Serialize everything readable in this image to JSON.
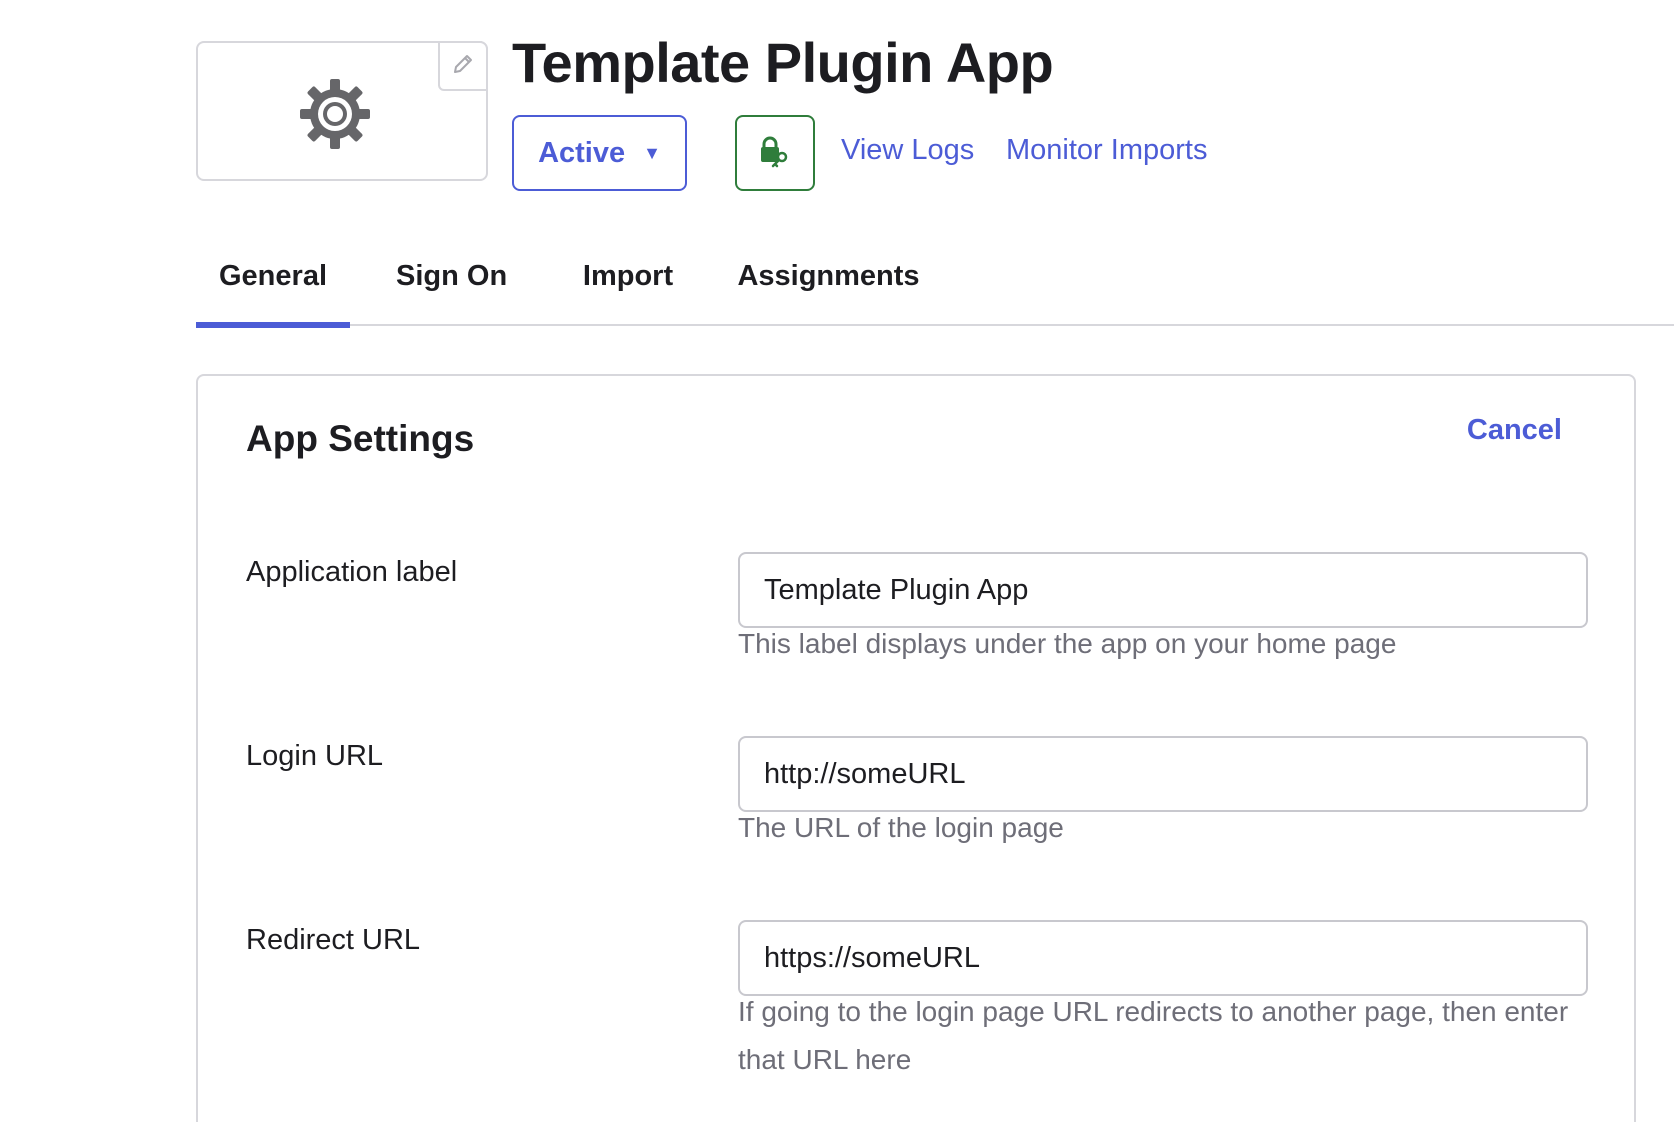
{
  "header": {
    "title": "Template Plugin App",
    "status_label": "Active",
    "links": {
      "view_logs": "View Logs",
      "monitor_imports": "Monitor Imports"
    },
    "icons": {
      "logo": "gear-icon",
      "edit": "pencil-icon",
      "provisioning": "lock-key-icon",
      "status_caret": "caret-down-icon"
    }
  },
  "tabs": [
    {
      "label": "General",
      "active": true
    },
    {
      "label": "Sign On",
      "active": false
    },
    {
      "label": "Import",
      "active": false
    },
    {
      "label": "Assignments",
      "active": false
    }
  ],
  "app_settings": {
    "title": "App Settings",
    "cancel_label": "Cancel",
    "fields": [
      {
        "label": "Application label",
        "value": "Template Plugin App",
        "help": "This label displays under the app on your home page"
      },
      {
        "label": "Login URL",
        "value": "http://someURL",
        "help": "The URL of the login page"
      },
      {
        "label": "Redirect URL",
        "value": "https://someURL",
        "help": "If going to the login page URL redirects to another page, then enter that URL here"
      }
    ]
  },
  "colors": {
    "accent": "#4c5cd6",
    "provisioning_green": "#2f7d3b",
    "text": "#1d1d21",
    "muted": "#6e6e78",
    "border": "#d7d7dc"
  }
}
